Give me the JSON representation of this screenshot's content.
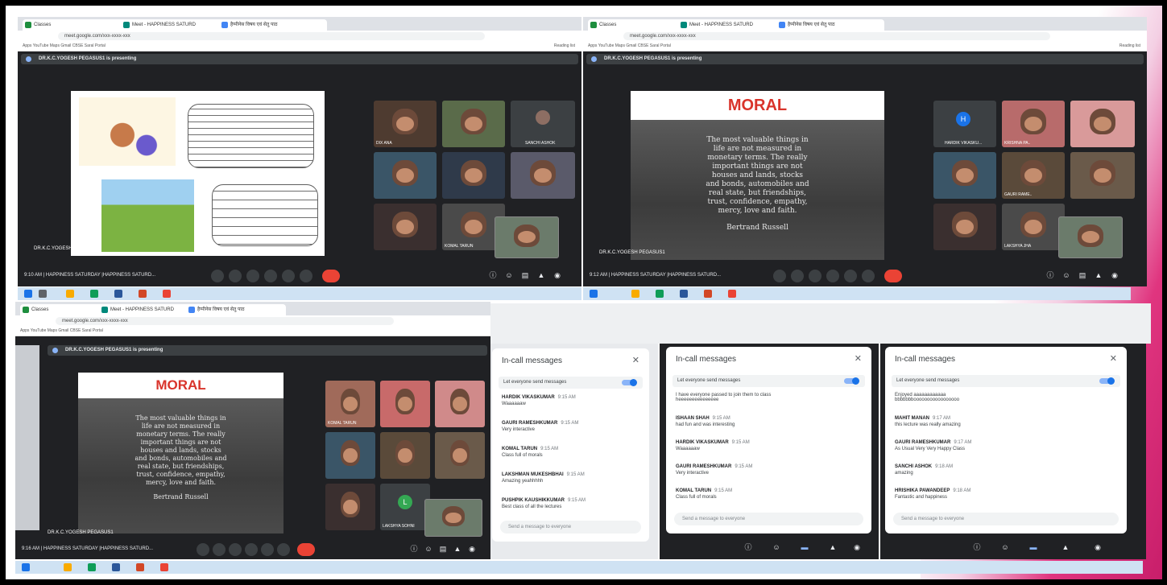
{
  "colors": {
    "meet_dark": "#202124",
    "accent_blue": "#1a73e8",
    "end_call_red": "#ea4335",
    "moral_red": "#d9342b",
    "pink_deco": "#e0357f"
  },
  "browser": {
    "tabs": [
      "Classes",
      "Meet - HAPPINESS SATURD",
      "हैप्पीनेस विषय एवं सेतु पाठ"
    ],
    "url": "meet.google.com/xxx-xxxx-xxx",
    "bookmarks": "Apps   YouTube   Maps   Gmail   CBSE Saral Portal",
    "reading_list": "Reading list"
  },
  "presenting_label": "DR.K.C.YOGESH PEGASUS1 is presenting",
  "presenter_name": "DR.K.C.YOGESH PEGASUS1",
  "moral": {
    "title": "MORAL",
    "quote": "The most valuable things in\nlife are not measured in\nmonetary terms. The really\nimportant things are not\nhouses and lands, stocks\nand bonds, automobiles and\nreal state, but friendships,\ntrust, confidence, empathy,\nmercy, love and faith.",
    "author": "Bertrand Russell"
  },
  "calls": [
    {
      "time": "9:10 AM",
      "title": "HAPPINESS SATURDAY |HAPPINESS SATURD..."
    },
    {
      "time": "9:12 AM",
      "title": "HAPPINESS SATURDAY |HAPPINESS SATURD..."
    },
    {
      "time": "9:16 AM",
      "title": "HAPPINESS SATURDAY |HAPPINESS SATURD..."
    }
  ],
  "participants_tl": [
    "DIX ANA",
    "SANCHI ASHOK",
    "KOMAL TARUN"
  ],
  "participants_tr": [
    "HARDIK VIKASKU...",
    "GAURI RAME..",
    "KRISHNA PA..",
    "SAHIL",
    "LAKSHYA JHA"
  ],
  "participants_bl": [
    "KOMAL TARUN",
    "LAKSHYA SOHNI"
  ],
  "chat_title": "In-call messages",
  "chat_toggle": "Let everyone send messages",
  "chat_placeholder": "Send a message to everyone",
  "chat_a": [
    {
      "who": "HARDIK VIKASKUMAR",
      "t": "9:15 AM",
      "txt": "Waaaaaaw"
    },
    {
      "who": "GAURI RAMESHKUMAR",
      "t": "9:15 AM",
      "txt": "Very interactive"
    },
    {
      "who": "KOMAL TARUN",
      "t": "9:15 AM",
      "txt": "Class full of morals"
    },
    {
      "who": "LAKSHMAN MUKESHBHAI",
      "t": "9:15 AM",
      "txt": "Amazing yeahhhhh"
    },
    {
      "who": "PUSHPIK KAUSHIKKUMAR",
      "t": "9:15 AM",
      "txt": "Best class of all the lectures"
    }
  ],
  "chat_b": [
    {
      "who": "",
      "t": "",
      "txt": "I have everyone passed to join them to class\nheeeeeeeeeeeeeee"
    },
    {
      "who": "ISHAAN SHAH",
      "t": "9:15 AM",
      "txt": "had fun and was interesting"
    },
    {
      "who": "HARDIK VIKASKUMAR",
      "t": "9:15 AM",
      "txt": "Waaaaaaw"
    },
    {
      "who": "GAURI RAMESHKUMAR",
      "t": "9:15 AM",
      "txt": "Very interactive"
    },
    {
      "who": "KOMAL TARUN",
      "t": "9:15 AM",
      "txt": "Class full of morals"
    }
  ],
  "chat_c": [
    {
      "who": "",
      "t": "",
      "txt": "Enjoyed aaaaaaaaaaaa\nbbbbbbbooooooooooooooooo"
    },
    {
      "who": "MAHIT MANAN",
      "t": "9:17 AM",
      "txt": "this lecture was really amazing"
    },
    {
      "who": "GAURI RAMESHKUMAR",
      "t": "9:17 AM",
      "txt": "As Usual Very Very Happy Class"
    },
    {
      "who": "SANCHI ASHOK",
      "t": "9:18 AM",
      "txt": "amazing"
    },
    {
      "who": "HRISHIKA PAWANDEEP",
      "t": "9:18 AM",
      "txt": "Fantastic and happiness"
    }
  ]
}
